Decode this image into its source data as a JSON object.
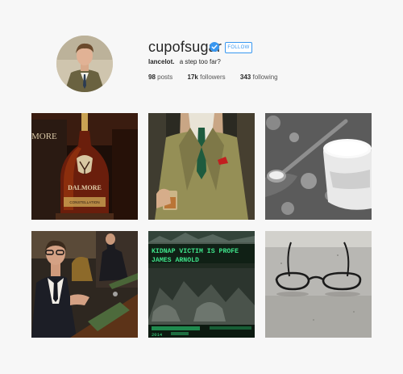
{
  "profile": {
    "username": "cupofsugar",
    "follow_label": "FOLLOW",
    "full_name": "lancelot.",
    "bio_text": "a step too far?",
    "stats": {
      "posts_count": "98",
      "posts_label": "posts",
      "followers_count": "17k",
      "followers_label": "followers",
      "following_count": "343",
      "following_label": "following"
    }
  },
  "posts": {
    "p1": {
      "brand_text": "DALMORE",
      "label_text": "CONSTELLATION",
      "side_text": "MORE"
    },
    "p5": {
      "headline_1": "KIDNAP VICTIM IS PROFE",
      "headline_2": "JAMES ARNOLD",
      "tag_year": "2014"
    }
  },
  "colors": {
    "accent": "#3897f0",
    "background": "#f7f7f7"
  }
}
